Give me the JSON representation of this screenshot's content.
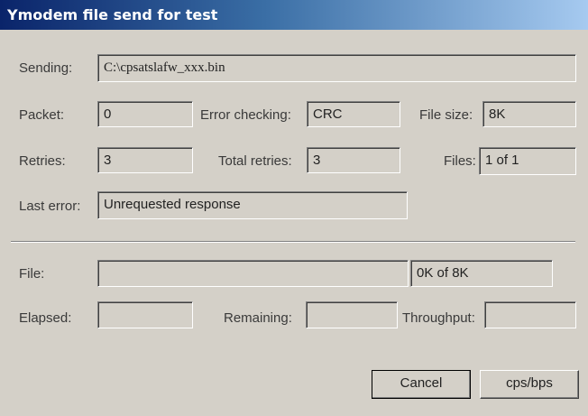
{
  "window": {
    "title": "Ymodem file send for test"
  },
  "sending": {
    "label": "Sending:",
    "value": "C:\\cpsatslafw_xxx.bin"
  },
  "packet": {
    "label": "Packet:",
    "value": "0"
  },
  "error_checking": {
    "label": "Error checking:",
    "value": "CRC"
  },
  "file_size": {
    "label": "File size:",
    "value": "8K"
  },
  "retries": {
    "label": "Retries:",
    "value": "3"
  },
  "total_retries": {
    "label": "Total retries:",
    "value": "3"
  },
  "files": {
    "label": "Files:",
    "value": "1 of 1"
  },
  "last_error": {
    "label": "Last error:",
    "value": "Unrequested response"
  },
  "file_progress": {
    "label": "File:",
    "progress_fraction": 0,
    "status": "0K of 8K"
  },
  "elapsed": {
    "label": "Elapsed:",
    "value": ""
  },
  "remaining": {
    "label": "Remaining:",
    "value": ""
  },
  "throughput": {
    "label": "Throughput:",
    "value": ""
  },
  "buttons": {
    "cancel": "Cancel",
    "cps_bps": "cps/bps"
  },
  "colors": {
    "title_bar": "#0a246a",
    "dialog_face": "#d4d0c8"
  }
}
